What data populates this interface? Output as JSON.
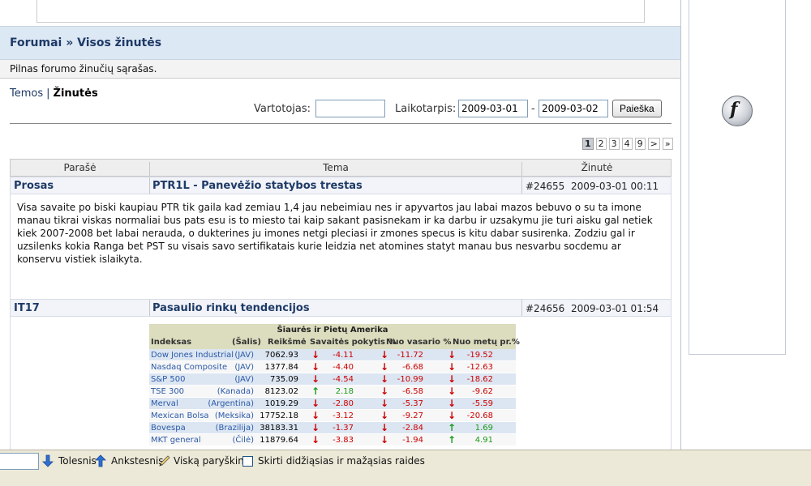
{
  "breadcrumb": "Forumai » Visos žinutės",
  "description": "Pilnas forumo žinučių sąrašas.",
  "tabs": {
    "topics": "Temos",
    "separator": "|",
    "messages": "Žinutės"
  },
  "filter": {
    "user_label": "Vartotojas:",
    "user_value": "",
    "period_label": "Laikotarpis:",
    "date_from": "2009-03-01",
    "dash": "-",
    "date_to": "2009-03-02",
    "search_button": "Paieška"
  },
  "pager": {
    "pages": [
      "1",
      "2",
      "3",
      "4",
      "9",
      ">",
      "»"
    ],
    "current": "1"
  },
  "table_headers": {
    "author": "Parašė",
    "topic": "Tema",
    "message": "Žinutė"
  },
  "posts": [
    {
      "author": "Prosas",
      "subject": "PTR1L - Panevėžio statybos trestas",
      "id": "#24655",
      "date": "2009-03-01 00:11",
      "text": "Visa savaite po biski kaupiau PTR tik gaila kad zemiau 1,4 jau nebeimiau nes ir apyvartos jau labai mazos bebuvo o su ta imone manau tikrai viskas normaliai bus pats esu is to miesto tai kaip sakant pasisnekam ir ka darbu ir uzsakymu jie turi aisku gal netiek kiek 2007-2008 bet labai nerauda, o dukterines ju imones netgi pleciasi ir zmones specus is kitu dabar susirenka. Zodziu gal ir uzsilenks kokia Ranga bet PST su visais savo sertifikatais kurie leidzia net atomines statyt manau bus nesvarbu socdemu ar konservu vistiek islaikyta."
    },
    {
      "author": "IT17",
      "subject": "Pasaulio rinkų tendencijos",
      "id": "#24656",
      "date": "2009-03-01 01:54",
      "text": ""
    }
  ],
  "market_table": {
    "title": "Šiaurės ir Pietų Amerika",
    "headers": {
      "index": "Indeksas",
      "country": "(Šalis)",
      "value": "Reikšmė",
      "week": "Savaitės pokytis %",
      "feb": "Nuo vasario %",
      "ytd": "Nuo metų pr.%"
    },
    "rows": [
      {
        "name": "Dow Jones Industrial",
        "country": "(JAV)",
        "value": "7062.93",
        "week": "-4.11",
        "feb": "-11.72",
        "ytd": "-19.52"
      },
      {
        "name": "Nasdaq Composite",
        "country": "(JAV)",
        "value": "1377.84",
        "week": "-4.40",
        "feb": "-6.68",
        "ytd": "-12.63"
      },
      {
        "name": "S&P 500",
        "country": "(JAV)",
        "value": "735.09",
        "week": "-4.54",
        "feb": "-10.99",
        "ytd": "-18.62"
      },
      {
        "name": "TSE 300",
        "country": "(Kanada)",
        "value": "8123.02",
        "week": "2.18",
        "feb": "-6.58",
        "ytd": "-9.62"
      },
      {
        "name": "Merval",
        "country": "(Argentina)",
        "value": "1019.29",
        "week": "-2.80",
        "feb": "-5.37",
        "ytd": "-5.59"
      },
      {
        "name": "Mexican Bolsa",
        "country": "(Meksika)",
        "value": "17752.18",
        "week": "-3.12",
        "feb": "-9.27",
        "ytd": "-20.68"
      },
      {
        "name": "Bovespa",
        "country": "(Brazilija)",
        "value": "38183.31",
        "week": "-1.37",
        "feb": "-2.84",
        "ytd": "1.69"
      },
      {
        "name": "MKT general",
        "country": "(Čilė)",
        "value": "11879.64",
        "week": "-3.83",
        "feb": "-1.94",
        "ytd": "4.91"
      }
    ]
  },
  "findbar": {
    "next": "Tolesnis",
    "previous": "Ankstesnis",
    "highlight_all": "Viską paryškinti",
    "match_case": "Skirti didžiąsias ir mažąsias raides"
  },
  "colors": {
    "link": "#1e3a66",
    "title_bg": "#dde8f5",
    "negative": "#cc0000",
    "positive": "#1a9a1a",
    "table_head": "#dcdcbe",
    "row_blue": "#dce6f2"
  },
  "icons": {
    "sidebar": "flash-player-icon",
    "next": "arrow-down-icon",
    "previous": "arrow-up-icon",
    "highlight": "highlighter-icon"
  }
}
